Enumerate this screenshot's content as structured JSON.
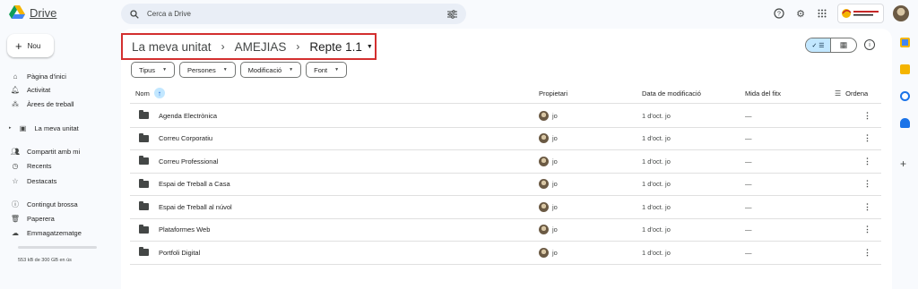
{
  "header": {
    "app_name": "Drive",
    "search_placeholder": "Cerca a Drive",
    "brand_colors": {
      "blue": "#4285f4",
      "green": "#0f9d58",
      "yellow": "#f4b400",
      "red": "#db4437"
    },
    "org_badge": "INSTITUT CASTELLBISBAL"
  },
  "sidebar": {
    "new_label": "Nou",
    "items": [
      {
        "label": "Pàgina d'inici",
        "icon": "home-icon"
      },
      {
        "label": "Activitat",
        "icon": "bell-icon"
      },
      {
        "label": "Àrees de treball",
        "icon": "workspaces-icon"
      },
      {
        "label": "La meva unitat",
        "icon": "my-drive-icon"
      },
      {
        "label": "Compartit amb mi",
        "icon": "shared-icon"
      },
      {
        "label": "Recents",
        "icon": "clock-icon"
      },
      {
        "label": "Destacats",
        "icon": "star-icon"
      },
      {
        "label": "Contingut brossa",
        "icon": "spam-icon"
      },
      {
        "label": "Paperera",
        "icon": "trash-icon"
      },
      {
        "label": "Emmagatzematge",
        "icon": "cloud-icon"
      }
    ],
    "storage_text": "553 kB de 300 GB en ús",
    "storage_fraction": 0.0
  },
  "breadcrumb": {
    "root": "La meva unitat",
    "parent": "AMEJIAS",
    "current": "Repte 1.1"
  },
  "filters": [
    "Tipus",
    "Persones",
    "Modificació",
    "Font"
  ],
  "columns": {
    "name": "Nom",
    "owner": "Propietari",
    "modified": "Data de modificació",
    "size": "Mida del fitx",
    "sort": "Ordena"
  },
  "rows": [
    {
      "name": "Agenda Electrònica",
      "owner": "jo",
      "modified": "1 d'oct. jo",
      "size": "—"
    },
    {
      "name": "Correu Corporatiu",
      "owner": "jo",
      "modified": "1 d'oct. jo",
      "size": "—"
    },
    {
      "name": "Correu Professional",
      "owner": "jo",
      "modified": "1 d'oct. jo",
      "size": "—"
    },
    {
      "name": "Espai de Treball a Casa",
      "owner": "jo",
      "modified": "1 d'oct. jo",
      "size": "—"
    },
    {
      "name": "Espai de Treball al núvol",
      "owner": "jo",
      "modified": "1 d'oct. jo",
      "size": "—"
    },
    {
      "name": "Plataformes Web",
      "owner": "jo",
      "modified": "1 d'oct. jo",
      "size": "—"
    },
    {
      "name": "Portfoli Digital",
      "owner": "jo",
      "modified": "1 d'oct. jo",
      "size": "—"
    }
  ],
  "accent": {
    "highlight_border": "#d32f2f",
    "selected_view": "#c2e7ff"
  }
}
